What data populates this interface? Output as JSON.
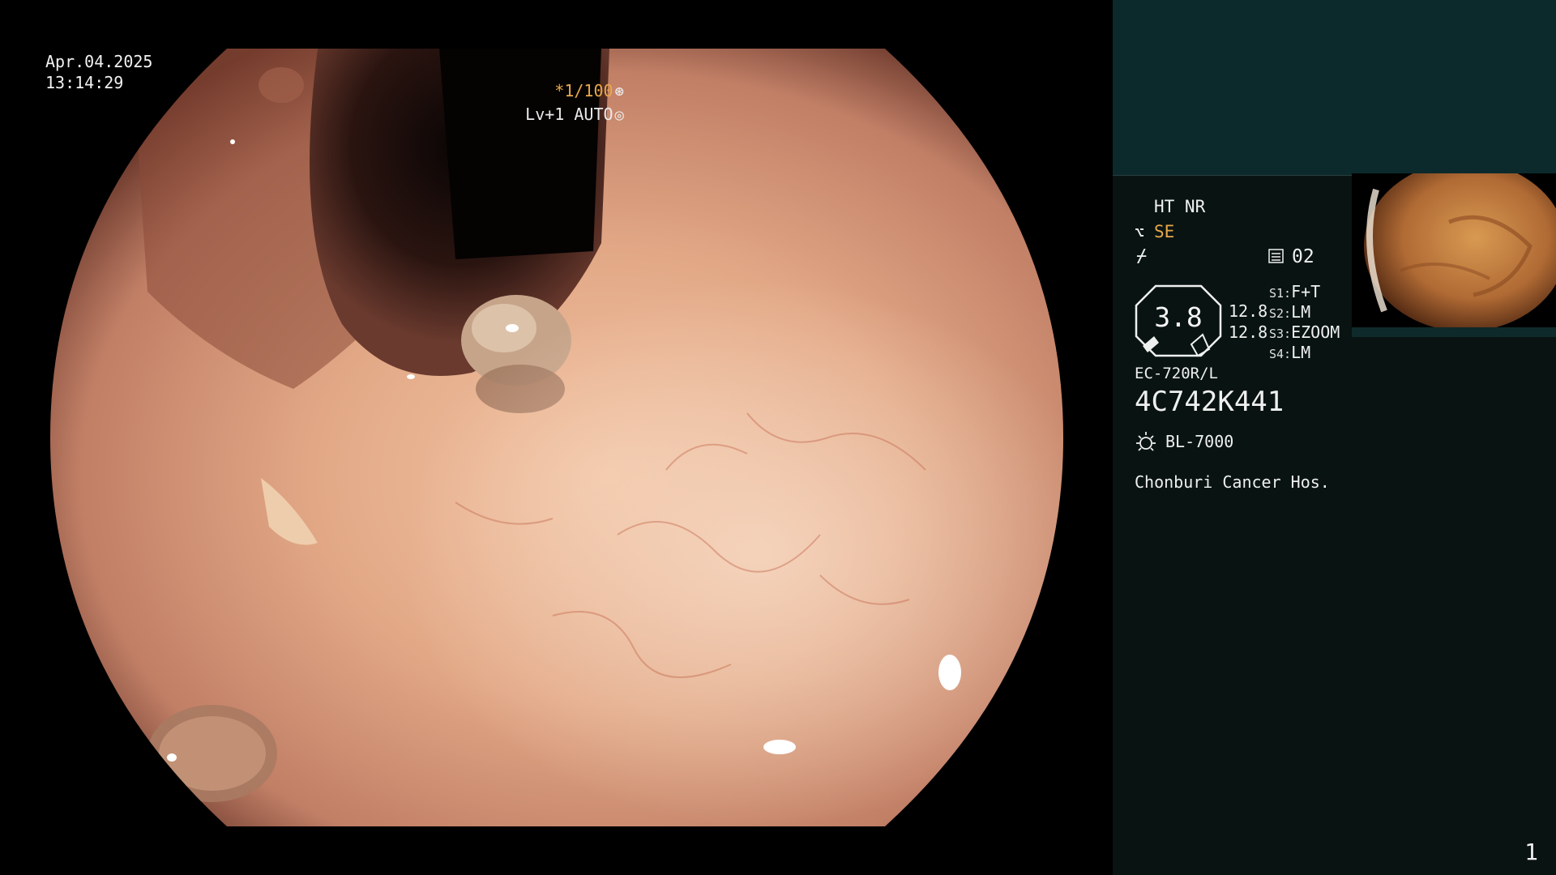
{
  "osd": {
    "date": "Apr.04.2025",
    "time": "13:14:29",
    "shutter": "*1/100",
    "level": "Lv+1 AUTO"
  },
  "panel": {
    "mode": "HT NR",
    "enhance_mode": "SE",
    "memory": "02",
    "gauge_value": "3.8",
    "value_upper": "12.8",
    "value_lower": "12.8",
    "switches": [
      {
        "label": "S1:",
        "value": "F+T"
      },
      {
        "label": "S2:",
        "value": "LM"
      },
      {
        "label": "S3:",
        "value": "EZOOM"
      },
      {
        "label": "S4:",
        "value": "LM"
      }
    ],
    "scope_model": "EC-720R/L",
    "scope_serial": "4C742K441",
    "light_source": "BL-7000",
    "hospital": "Chonburi Cancer Hos.",
    "page_number": "1"
  },
  "icons": {
    "shutter_glyph": "aperture-icon",
    "level_glyph": "iris-icon",
    "enhance_glyph": "structure-icon",
    "color_glyph": "color-tone-icon",
    "memory_glyph": "memory-icon",
    "light_glyph": "lamp-icon"
  },
  "colors": {
    "accent": "#e8a84a",
    "panel_top": "#0c2a2c",
    "panel_bottom": "#091312",
    "mucosa": "#d89a7c"
  }
}
